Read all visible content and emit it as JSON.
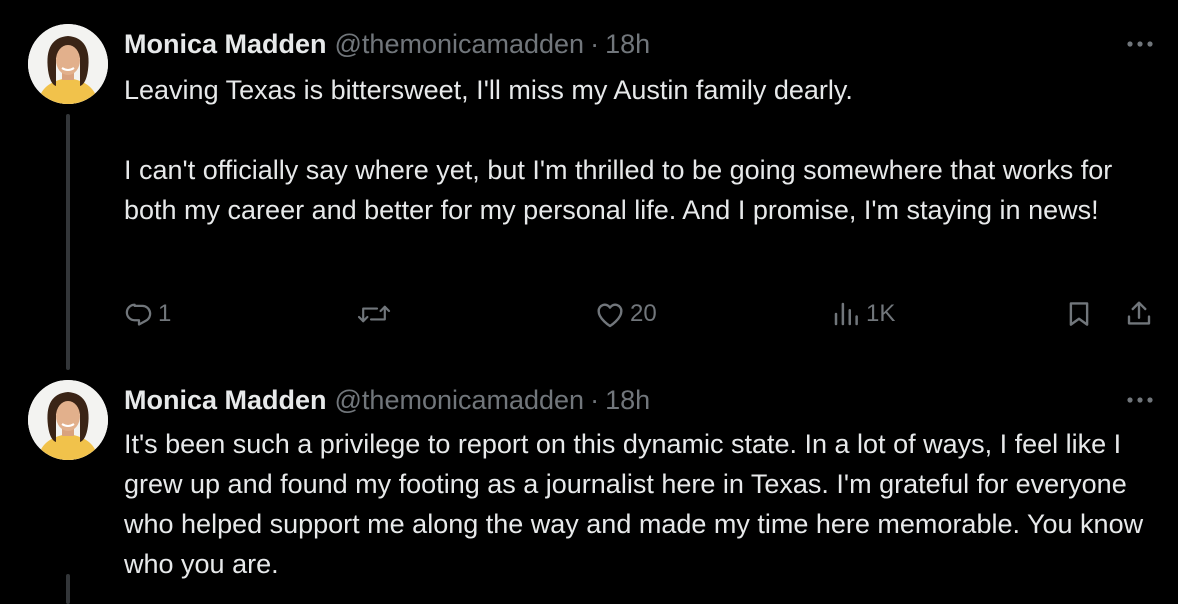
{
  "tweets": [
    {
      "author": {
        "display_name": "Monica Madden",
        "handle": "@themonicamadden"
      },
      "separator": "·",
      "time": "18h",
      "paragraphs": [
        "Leaving Texas is bittersweet, I'll miss my Austin family dearly.",
        "I can't officially say where yet, but I'm thrilled to be going somewhere that works for both my career and better for my personal life. And I promise, I'm staying in news!"
      ],
      "actions": {
        "replies": "1",
        "retweets": "",
        "likes": "20",
        "views": "1K"
      }
    },
    {
      "author": {
        "display_name": "Monica Madden",
        "handle": "@themonicamadden"
      },
      "separator": "·",
      "time": "18h",
      "paragraphs": [
        "It's been such a privilege to report on this dynamic state. In a lot of ways, I feel like I grew up and found my footing as a journalist here in Texas. I'm grateful for everyone who helped support me along the way and made my time here memorable. You know who you are."
      ]
    }
  ],
  "icons": {
    "more": "more-horizontal-icon",
    "reply": "reply-icon",
    "retweet": "retweet-icon",
    "like": "heart-icon",
    "views": "views-icon",
    "bookmark": "bookmark-icon",
    "share": "share-icon"
  },
  "colors": {
    "background": "#000000",
    "text_primary": "#e7e9ea",
    "text_secondary": "#71767b",
    "thread_line": "#333639"
  }
}
